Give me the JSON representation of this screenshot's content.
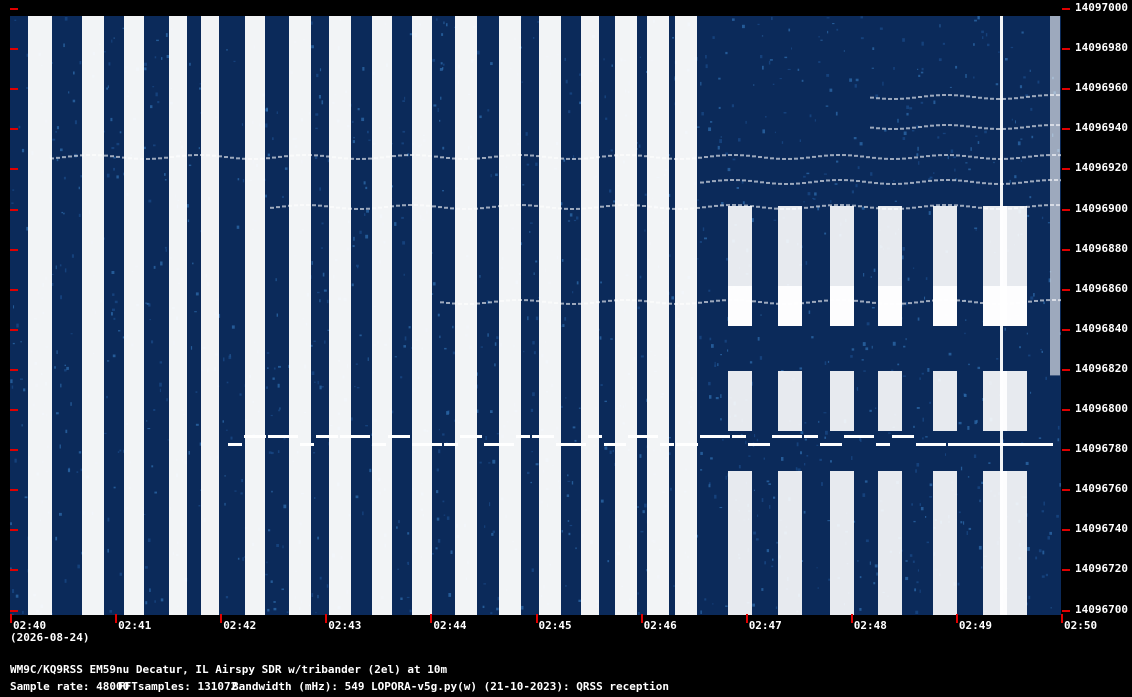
{
  "freq_labels": [
    "14097000",
    "14096980",
    "14096960",
    "14096940",
    "14096920",
    "14096900",
    "14096880",
    "14096860",
    "14096840",
    "14096820",
    "14096800",
    "14096780",
    "14096760",
    "14096740",
    "14096720",
    "14096700"
  ],
  "time_labels": [
    "02:40",
    "02:41",
    "02:42",
    "02:43",
    "02:44",
    "02:45",
    "02:46",
    "02:47",
    "02:48",
    "02:49",
    "02:50"
  ],
  "date_label": "(2026-08-24)",
  "station_line": "WM9C/KQ9RSS EM59nu Decatur, IL  Airspy SDR w/tribander (2el) at 10m",
  "params": {
    "sample_rate": "Sample rate: 48000",
    "fft_samples": "FFTsamples: 131072",
    "bandwidth": "Bandwidth (mHz): 549",
    "software": "LOPORA-v5g.py(w) (21-10-2023): QRSS reception"
  },
  "colors": {
    "background": "#0b2a5a",
    "signal": "#ffffff",
    "tick": "#e00000",
    "text": "#ffffff"
  }
}
